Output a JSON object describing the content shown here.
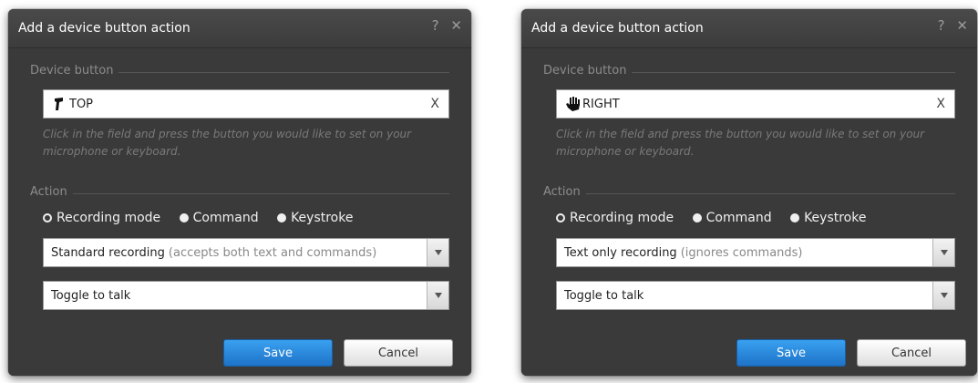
{
  "dialogs": [
    {
      "title": "Add a device button action",
      "help_glyph": "?",
      "close_glyph": "✕",
      "device_section_label": "Device button",
      "device_value": "TOP",
      "device_icon": "foot-pedal-icon",
      "clear_label": "X",
      "hint": "Click in the field and press the button you would like to set on your microphone or keyboard.",
      "action_section_label": "Action",
      "radios": [
        {
          "label": "Recording mode",
          "selected": true
        },
        {
          "label": "Command",
          "selected": false
        },
        {
          "label": "Keystroke",
          "selected": false
        }
      ],
      "mode_select": {
        "value": "Standard recording",
        "sub": "(accepts both text and commands)"
      },
      "trigger_select": {
        "value": "Toggle to talk"
      },
      "save_label": "Save",
      "cancel_label": "Cancel"
    },
    {
      "title": "Add a device button action",
      "help_glyph": "?",
      "close_glyph": "✕",
      "device_section_label": "Device button",
      "device_value": "RIGHT",
      "device_icon": "hand-icon",
      "clear_label": "X",
      "hint": "Click in the field and press the button you would like to set on your microphone or keyboard.",
      "action_section_label": "Action",
      "radios": [
        {
          "label": "Recording mode",
          "selected": true
        },
        {
          "label": "Command",
          "selected": false
        },
        {
          "label": "Keystroke",
          "selected": false
        }
      ],
      "mode_select": {
        "value": "Text only recording",
        "sub": "(ignores commands)"
      },
      "trigger_select": {
        "value": "Toggle to talk"
      },
      "save_label": "Save",
      "cancel_label": "Cancel"
    }
  ]
}
